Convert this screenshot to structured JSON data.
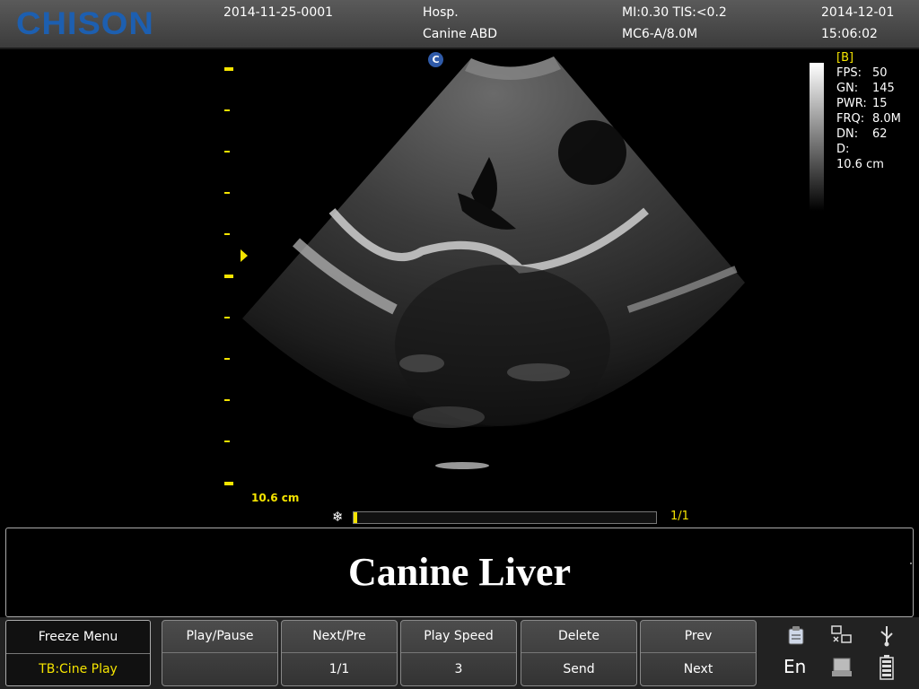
{
  "header": {
    "logo": "CHISON",
    "patient_id": "2014-11-25-0001",
    "hospital": "Hosp.",
    "exam": "Canine ABD",
    "mi_tis": "MI:0.30  TIS:<0.2",
    "probe": "MC6-A/8.0M",
    "date": "2014-12-01",
    "time": "15:06:02"
  },
  "image": {
    "orientation_badge": "C",
    "depth_label": "10.6 cm",
    "params": {
      "mode": "[B]",
      "rows": [
        {
          "key": "FPS:",
          "value": "50"
        },
        {
          "key": "GN:",
          "value": "145"
        },
        {
          "key": "PWR:",
          "value": "15"
        },
        {
          "key": "FRQ:",
          "value": "8.0M"
        },
        {
          "key": "DN:",
          "value": "62"
        },
        {
          "key": "D:",
          "value": "10.6 cm"
        }
      ]
    },
    "cine": {
      "frame_count": "1/1",
      "progress": 0.01
    }
  },
  "annotation": {
    "text": "Canine Liver"
  },
  "bottom": {
    "freeze_menu": {
      "title": "Freeze Menu",
      "trackball": "TB:Cine Play"
    },
    "softkeys": [
      {
        "top": "Play/Pause",
        "bottom": ""
      },
      {
        "top": "Next/Pre",
        "bottom": "1/1"
      },
      {
        "top": "Play Speed",
        "bottom": "3"
      },
      {
        "top": "Delete",
        "bottom": "Send"
      },
      {
        "top": "Prev",
        "bottom": "Next"
      }
    ],
    "language": "En",
    "icons": [
      "clipboard-icon",
      "network-icon",
      "usb-icon",
      "printer-icon",
      "battery-icon"
    ]
  },
  "colors": {
    "accent_yellow": "#f5e400",
    "logo_blue": "#1d5fb0",
    "badge_blue": "#2f5aa8"
  }
}
